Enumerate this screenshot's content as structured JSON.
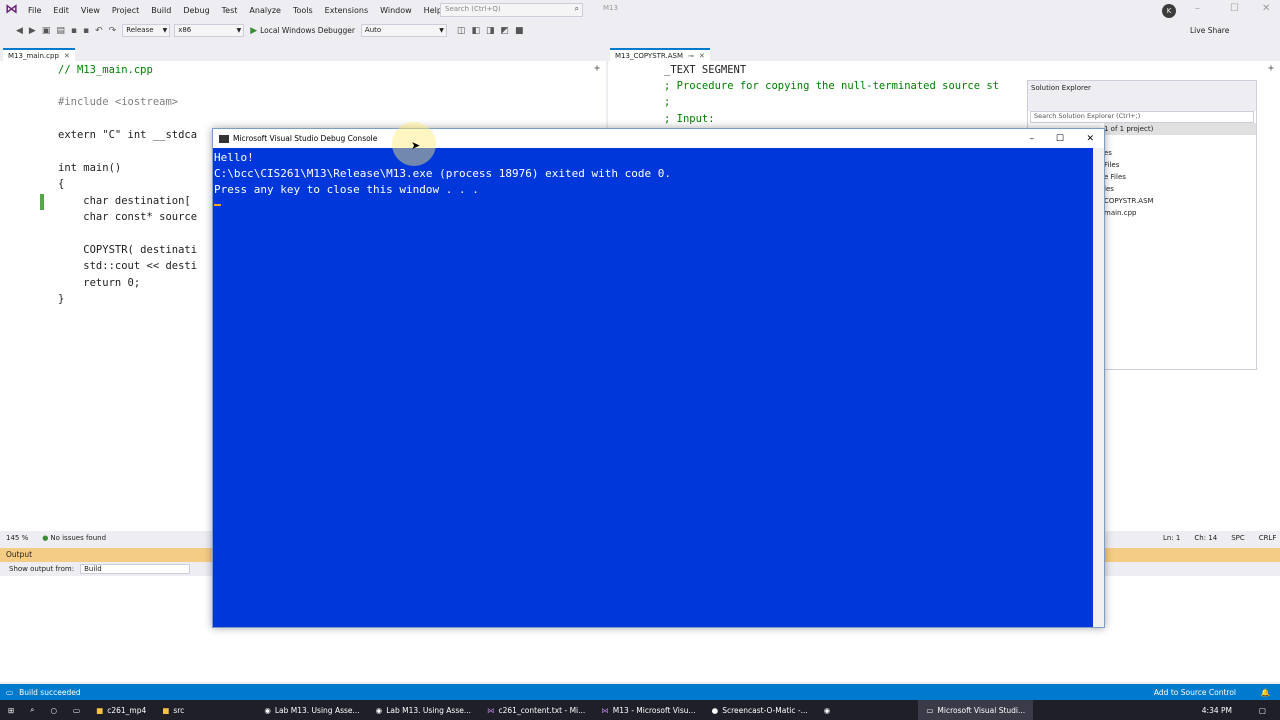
{
  "menu": [
    "File",
    "Edit",
    "View",
    "Project",
    "Build",
    "Debug",
    "Test",
    "Analyze",
    "Tools",
    "Extensions",
    "Window",
    "Help"
  ],
  "search": {
    "placeholder": "Search (Ctrl+Q)"
  },
  "solution_name": "M13",
  "user_initial": "K",
  "toolbar": {
    "config": "Release",
    "platform": "x86",
    "debugger": "Local Windows Debugger",
    "auto": "Auto",
    "live_share": "Live Share"
  },
  "left_tab": "M13_main.cpp",
  "right_tab": "M13_COPYSTR.ASM",
  "left_code": [
    "// M13_main.cpp",
    "",
    "#include <iostream>",
    "",
    "extern \"C\" int __stdca",
    "",
    "int main()",
    "{",
    "    char destination[",
    "    char const* source",
    "",
    "    COPYSTR( destinati",
    "    std::cout << desti",
    "    return 0;",
    "}"
  ],
  "right_code": [
    "_TEXT SEGMENT",
    "; Procedure for copying the null-terminated source st",
    ";",
    "; Input:"
  ],
  "zoom": "145 %",
  "issues": "No issues found",
  "position": {
    "ln": "Ln: 1",
    "ch": "Ch: 14",
    "spc": "SPC",
    "crlf": "CRLF"
  },
  "output": {
    "title": "Output",
    "show_from": "Show output from:",
    "source": "Build"
  },
  "solution_explorer": {
    "title": "Solution Explorer",
    "search": "Search Solution Explorer (Ctrl+;)",
    "items": [
      "1 of 1 project)",
      "es",
      "Files",
      "e Files",
      "les",
      "COPYSTR.ASM",
      "main.cpp"
    ]
  },
  "console": {
    "title": "Microsoft Visual Studio Debug Console",
    "lines": [
      "Hello!",
      "C:\\bcc\\CIS261\\M13\\Release\\M13.exe (process 18976) exited with code 0.",
      "Press any key to close this window . . ."
    ]
  },
  "status": {
    "left": "Build succeeded",
    "right": "Add to Source Control"
  },
  "taskbar": {
    "items": [
      "c261_mp4",
      "src",
      "Lab M13. Using Asse...",
      "Lab M13. Using Asse...",
      "c261_content.txt - Mi...",
      "M13 - Microsoft Visu...",
      "Screencast-O-Matic -...",
      "Microsoft Visual Studi..."
    ],
    "time": "4:34 PM"
  },
  "colors": {
    "accent": "#007acc",
    "console_bg": "#0037da"
  }
}
